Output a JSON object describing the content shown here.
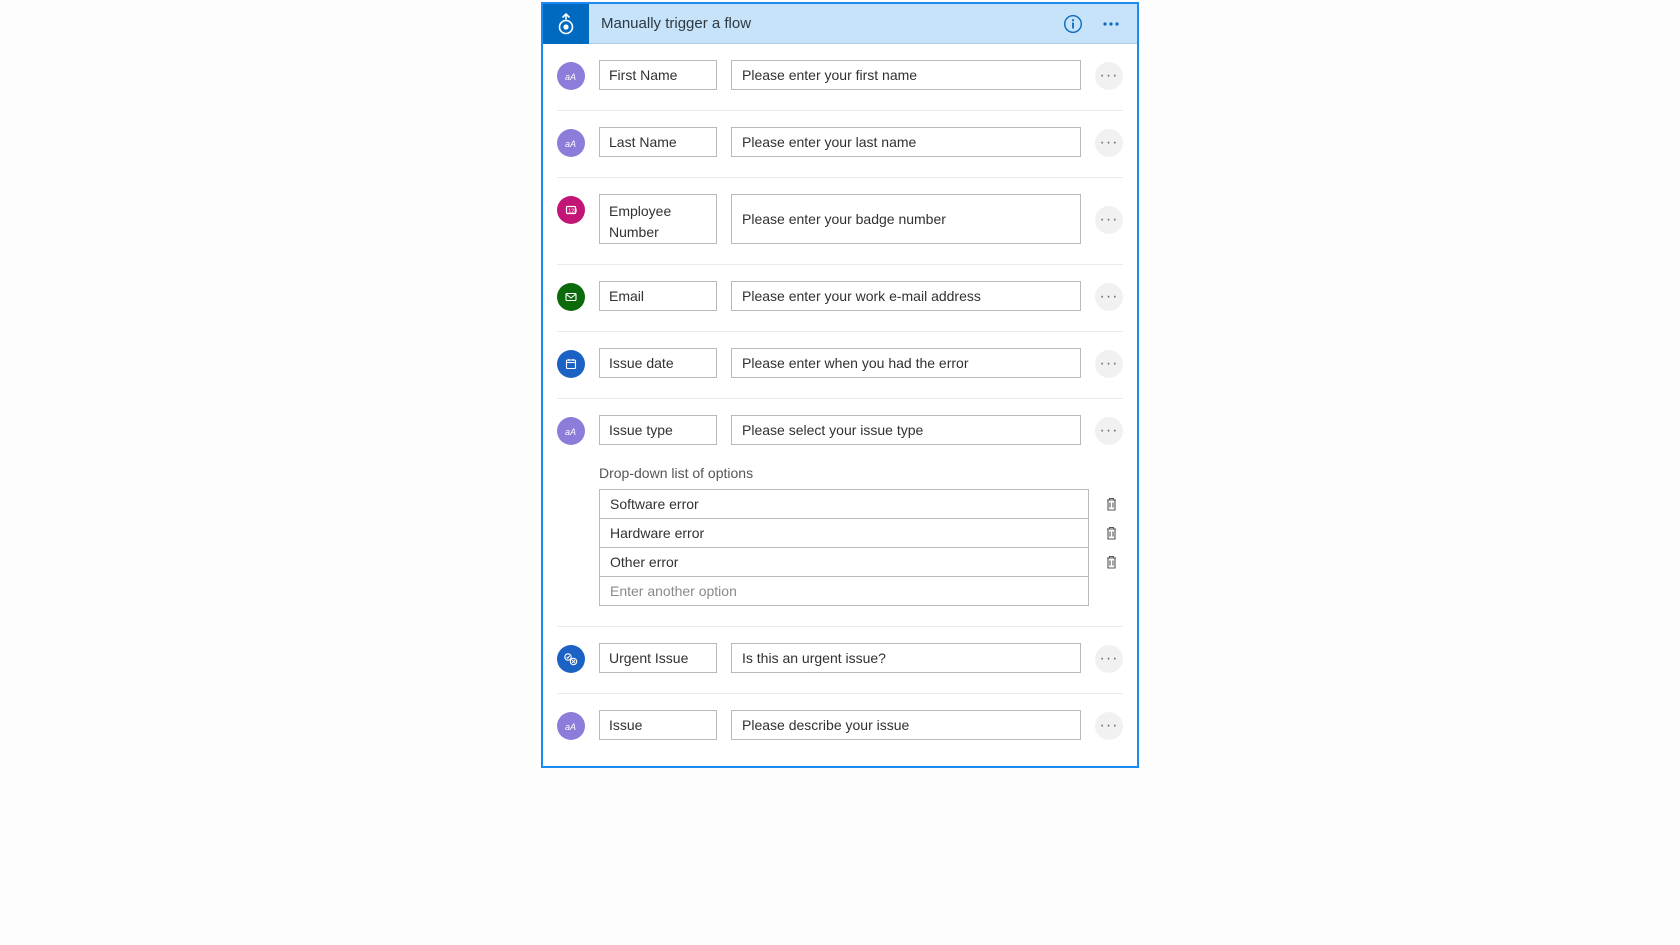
{
  "header": {
    "title": "Manually trigger a flow"
  },
  "inputs": [
    {
      "type": "text",
      "label": "First Name",
      "description": "Please enter your first name"
    },
    {
      "type": "text",
      "label": "Last Name",
      "description": "Please enter your last name"
    },
    {
      "type": "number",
      "label": "Employee Number",
      "description": "Please enter your badge number"
    },
    {
      "type": "email",
      "label": "Email",
      "description": "Please enter your work e-mail address"
    },
    {
      "type": "date",
      "label": "Issue date",
      "description": "Please enter when you had the error"
    },
    {
      "type": "text",
      "label": "Issue type",
      "description": "Please select your issue type",
      "dropdown": {
        "title": "Drop-down list of options",
        "options": [
          "Software error",
          "Hardware error",
          "Other error"
        ],
        "placeholder": "Enter another option"
      }
    },
    {
      "type": "yesno",
      "label": "Urgent Issue",
      "description": "Is this an urgent issue?"
    },
    {
      "type": "text",
      "label": "Issue",
      "description": "Please describe your issue"
    }
  ]
}
